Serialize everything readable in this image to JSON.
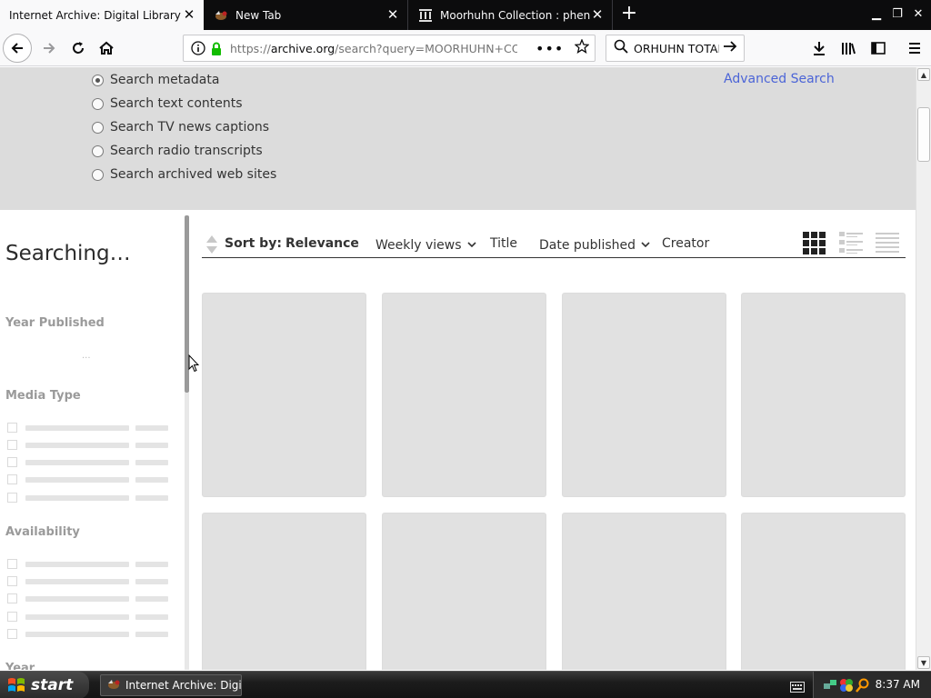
{
  "browser": {
    "tabs": [
      {
        "title": "Internet Archive: Digital Library of Free & Borrowable Books, Movies, Music & Wayback Machine",
        "active": true
      },
      {
        "title": "New Tab",
        "active": false
      },
      {
        "title": "Moorhuhn Collection : phenomedia",
        "active": false
      }
    ],
    "url_prefix": "https://",
    "url_host": "archive.org",
    "url_path": "/search?query=MOORHUHN+COLLECTION",
    "search_value": "ORHUHN TOTAL",
    "new_tab_glyph": "+",
    "overflow_glyph": "•••"
  },
  "search_options": {
    "radios": [
      {
        "label": "Search metadata",
        "checked": true
      },
      {
        "label": "Search text contents",
        "checked": false
      },
      {
        "label": "Search TV news captions",
        "checked": false
      },
      {
        "label": "Search radio transcripts",
        "checked": false
      },
      {
        "label": "Search archived web sites",
        "checked": false
      }
    ],
    "advanced_link": "Advanced Search"
  },
  "sidebar": {
    "status": "Searching…",
    "facets": [
      {
        "title": "Year Published",
        "placeholder": "..."
      },
      {
        "title": "Media Type"
      },
      {
        "title": "Availability"
      },
      {
        "title": "Year"
      }
    ]
  },
  "sort": {
    "label": "Sort by:",
    "options": [
      "Relevance",
      "Weekly views",
      "Title",
      "Date published",
      "Creator"
    ],
    "active": "Relevance"
  },
  "taskbar": {
    "start_label": "start",
    "task_item": "Internet Archive: Digi...",
    "clock": "8:37 AM"
  },
  "colors": {
    "accent_link": "#4b64d7",
    "options_bg": "#dcdcdc",
    "tile_placeholder": "#e1e1e1"
  }
}
